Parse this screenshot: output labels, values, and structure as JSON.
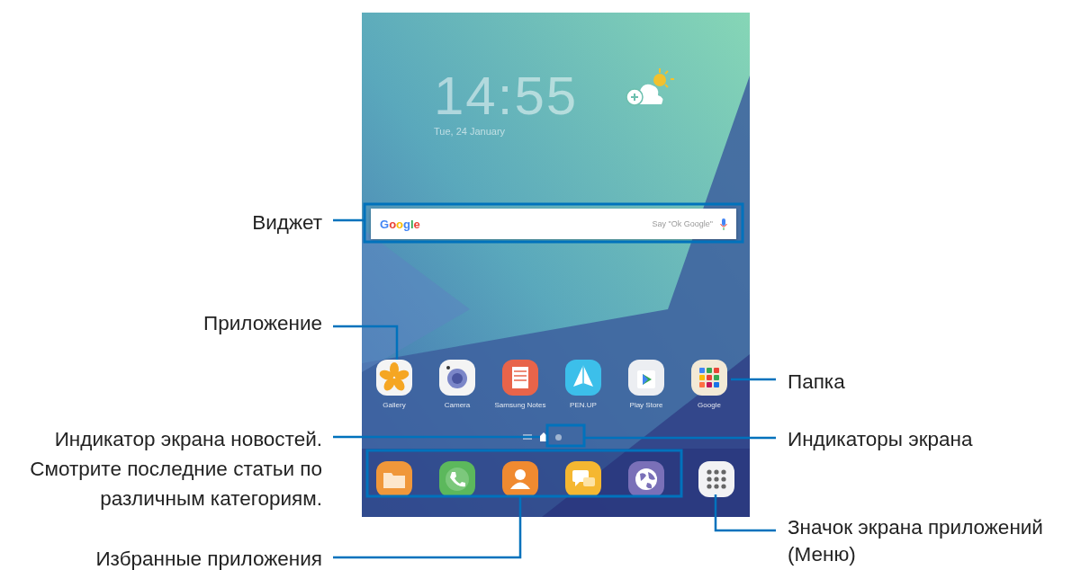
{
  "screen": {
    "clock": {
      "time": "14:55",
      "date": "Tue, 24 January"
    },
    "search_widget": {
      "logo": "Google",
      "placeholder": "Say \"Ok Google\""
    },
    "apps": [
      {
        "kind": "gallery",
        "label": "Gallery"
      },
      {
        "kind": "camera",
        "label": "Camera"
      },
      {
        "kind": "notes",
        "label": "Samsung Notes"
      },
      {
        "kind": "penup",
        "label": "PEN.UP"
      },
      {
        "kind": "playstore",
        "label": "Play Store"
      },
      {
        "kind": "folder",
        "label": "Google"
      }
    ],
    "page_indicators": [
      {
        "kind": "news",
        "selected": false
      },
      {
        "kind": "home",
        "selected": true
      },
      {
        "kind": "dot",
        "selected": false
      }
    ],
    "dock": [
      {
        "kind": "files"
      },
      {
        "kind": "phone"
      },
      {
        "kind": "contacts"
      },
      {
        "kind": "messages"
      },
      {
        "kind": "internet"
      }
    ],
    "apps_button": {
      "kind": "apps"
    }
  },
  "callouts": [
    {
      "text": "Виджет"
    },
    {
      "text": "Приложение"
    },
    {
      "text": "Папка"
    },
    {
      "text": "Индикатор экрана новостей. Смотрите последние статьи по различным категориям."
    },
    {
      "text": "Индикаторы экрана"
    },
    {
      "text": "Избранные приложения"
    },
    {
      "text": "Значок экрана приложений (Меню)"
    }
  ]
}
